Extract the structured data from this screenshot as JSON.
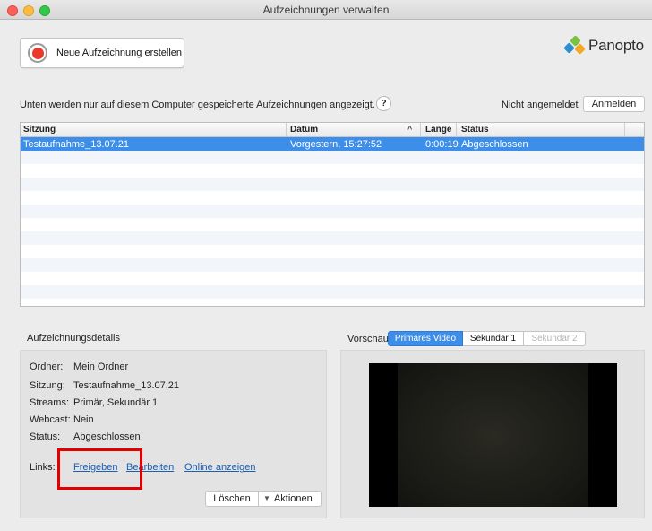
{
  "window": {
    "title": "Aufzeichnungen verwalten"
  },
  "toolbar": {
    "new_recording_label": "Neue Aufzeichnung erstellen"
  },
  "brand": {
    "logo_text": "Panopto"
  },
  "info": {
    "text": "Unten werden nur auf diesem Computer gespeicherte Aufzeichnungen angezeigt.",
    "help_label": "?",
    "login_status": "Nicht angemeldet",
    "login_button": "Anmelden"
  },
  "table": {
    "columns": [
      "Sitzung",
      "Datum",
      "Länge",
      "Status"
    ],
    "sort_indicator": "^",
    "rows": [
      {
        "session": "Testaufnahme_13.07.21",
        "date": "Vorgestern, 15:27:52",
        "length": "0:00:19",
        "status": "Abgeschlossen"
      }
    ]
  },
  "details": {
    "title": "Aufzeichnungsdetails",
    "folder_label": "Ordner:",
    "folder_value": "Mein Ordner",
    "session_label": "Sitzung:",
    "session_value": "Testaufnahme_13.07.21",
    "streams_label": "Streams:",
    "streams_value": "Primär, Sekundär 1",
    "webcast_label": "Webcast:",
    "webcast_value": "Nein",
    "status_label": "Status:",
    "status_value": "Abgeschlossen",
    "links_label": "Links:",
    "link_share": "Freigeben",
    "link_edit": "Bearbeiten",
    "link_view_online": "Online anzeigen",
    "delete_button": "Löschen",
    "actions_button": "Aktionen"
  },
  "preview": {
    "label": "Vorschau",
    "tabs": [
      {
        "label": "Primäres Video",
        "state": "selected"
      },
      {
        "label": "Sekundär 1",
        "state": "enabled"
      },
      {
        "label": "Sekundär 2",
        "state": "disabled"
      }
    ]
  },
  "colors": {
    "accent": "#3d8ee8",
    "record": "#e8392b",
    "highlight": "#e00000",
    "link": "#1a5fb4"
  }
}
